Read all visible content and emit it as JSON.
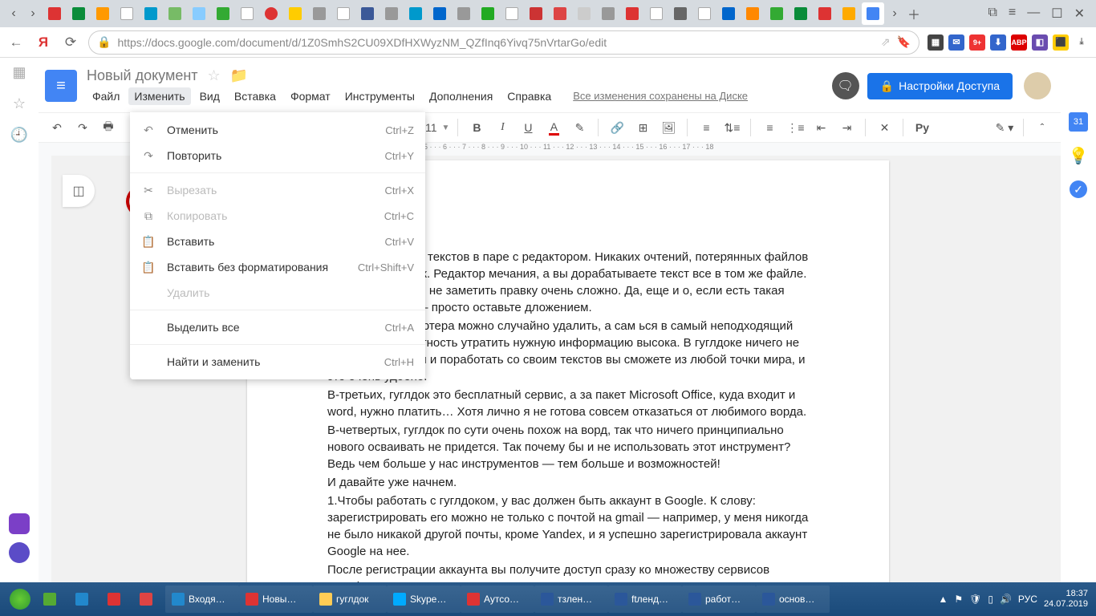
{
  "browser": {
    "url": "https://docs.google.com/document/d/1Z0SmhS2CU09XDfHXWyzNM_QZfInq6Yivq75nVrtarGo/edit"
  },
  "doc": {
    "title": "Новый документ",
    "menus": [
      "Файл",
      "Изменить",
      "Вид",
      "Вставка",
      "Формат",
      "Инструменты",
      "Дополнения",
      "Справка"
    ],
    "active_menu_index": 1,
    "saved_msg": "Все изменения сохранены на Диске",
    "share_label": "Настройки Доступа"
  },
  "toolbar": {
    "font_size": "11",
    "py": "Py"
  },
  "edit_menu": [
    {
      "icon": "↶",
      "label": "Отменить",
      "shortcut": "Ctrl+Z"
    },
    {
      "icon": "↷",
      "label": "Повторить",
      "shortcut": "Ctrl+Y"
    },
    {
      "div": true
    },
    {
      "icon": "✂",
      "label": "Вырезать",
      "shortcut": "Ctrl+X",
      "disabled": true
    },
    {
      "icon": "⧉",
      "label": "Копировать",
      "shortcut": "Ctrl+C",
      "disabled": true
    },
    {
      "icon": "📋",
      "label": "Вставить",
      "shortcut": "Ctrl+V"
    },
    {
      "icon": "📋",
      "label": "Вставить без форматирования",
      "shortcut": "Ctrl+Shift+V"
    },
    {
      "icon": "",
      "label": "Удалить",
      "shortcut": "",
      "disabled": true
    },
    {
      "div": true
    },
    {
      "icon": "",
      "label": "Выделить все",
      "shortcut": "Ctrl+A"
    },
    {
      "div": true
    },
    {
      "icon": "",
      "label": "Найти и заменить",
      "shortcut": "Ctrl+H"
    }
  ],
  "body_text": [
    "добно работать с текстов в паре с редактором. Никаких очтений, потерянных файлов и забытых правок. Редактор мечания, а вы дорабатываете текст все в том же файле. И ается работа, и не заметить правку очень сложно. Да, еще и о, если есть такая необходимость — просто оставьте дложением.",
    "ий файл с компьютера можно случайно удалить, а сам ься в самый неподходящий момент — вероятность утратить нужную информацию высока. В гуглдоке ничего не пропадет, а войти и поработать со своим текстов вы сможете из любой точки мира, и это очень удобно.",
    "В-третьих, гуглдок это бесплатный сервис, а за пакет Microsoft Office, куда входит и word, нужно платить… Хотя лично я не готова совсем отказаться от любимого ворда.",
    "В-четвертых, гуглдок по сути очень похож на ворд, так что ничего принципиально нового осваивать не придется. Так почему бы и не использовать этот инструмент? Ведь чем больше у нас инструментов — тем больше и возможностей!",
    "И давайте уже начнем.",
    "1.Чтобы работать с гуглдоком, у вас должен быть аккаунт в Google. К слову: зарегистрировать его можно не только с почтой на gmail — например, у меня никогда не было никакой другой почты, кроме Yandex, и я успешно зарегистрировала аккаунт Google на нее.",
    "После регистрации аккаунта вы получите доступ сразу ко множеству сервисов Google"
  ],
  "taskbar": {
    "items": [
      "Входя…",
      "Новы…",
      "гуглдок",
      "Skype…",
      "Аутсо…",
      "тзлен…",
      "ftленд…",
      "работ…",
      "основ…"
    ],
    "lang": "РУС",
    "time": "18:37",
    "date": "24.07.2019"
  },
  "ruler_text": "5 · · · 6 · · · 7 · · · 8 · · · 9 · · · 10 · · · 11 · · · 12 · · · 13 · · · 14 · · · 15 · · · 16 · · · 17 · · · 18"
}
